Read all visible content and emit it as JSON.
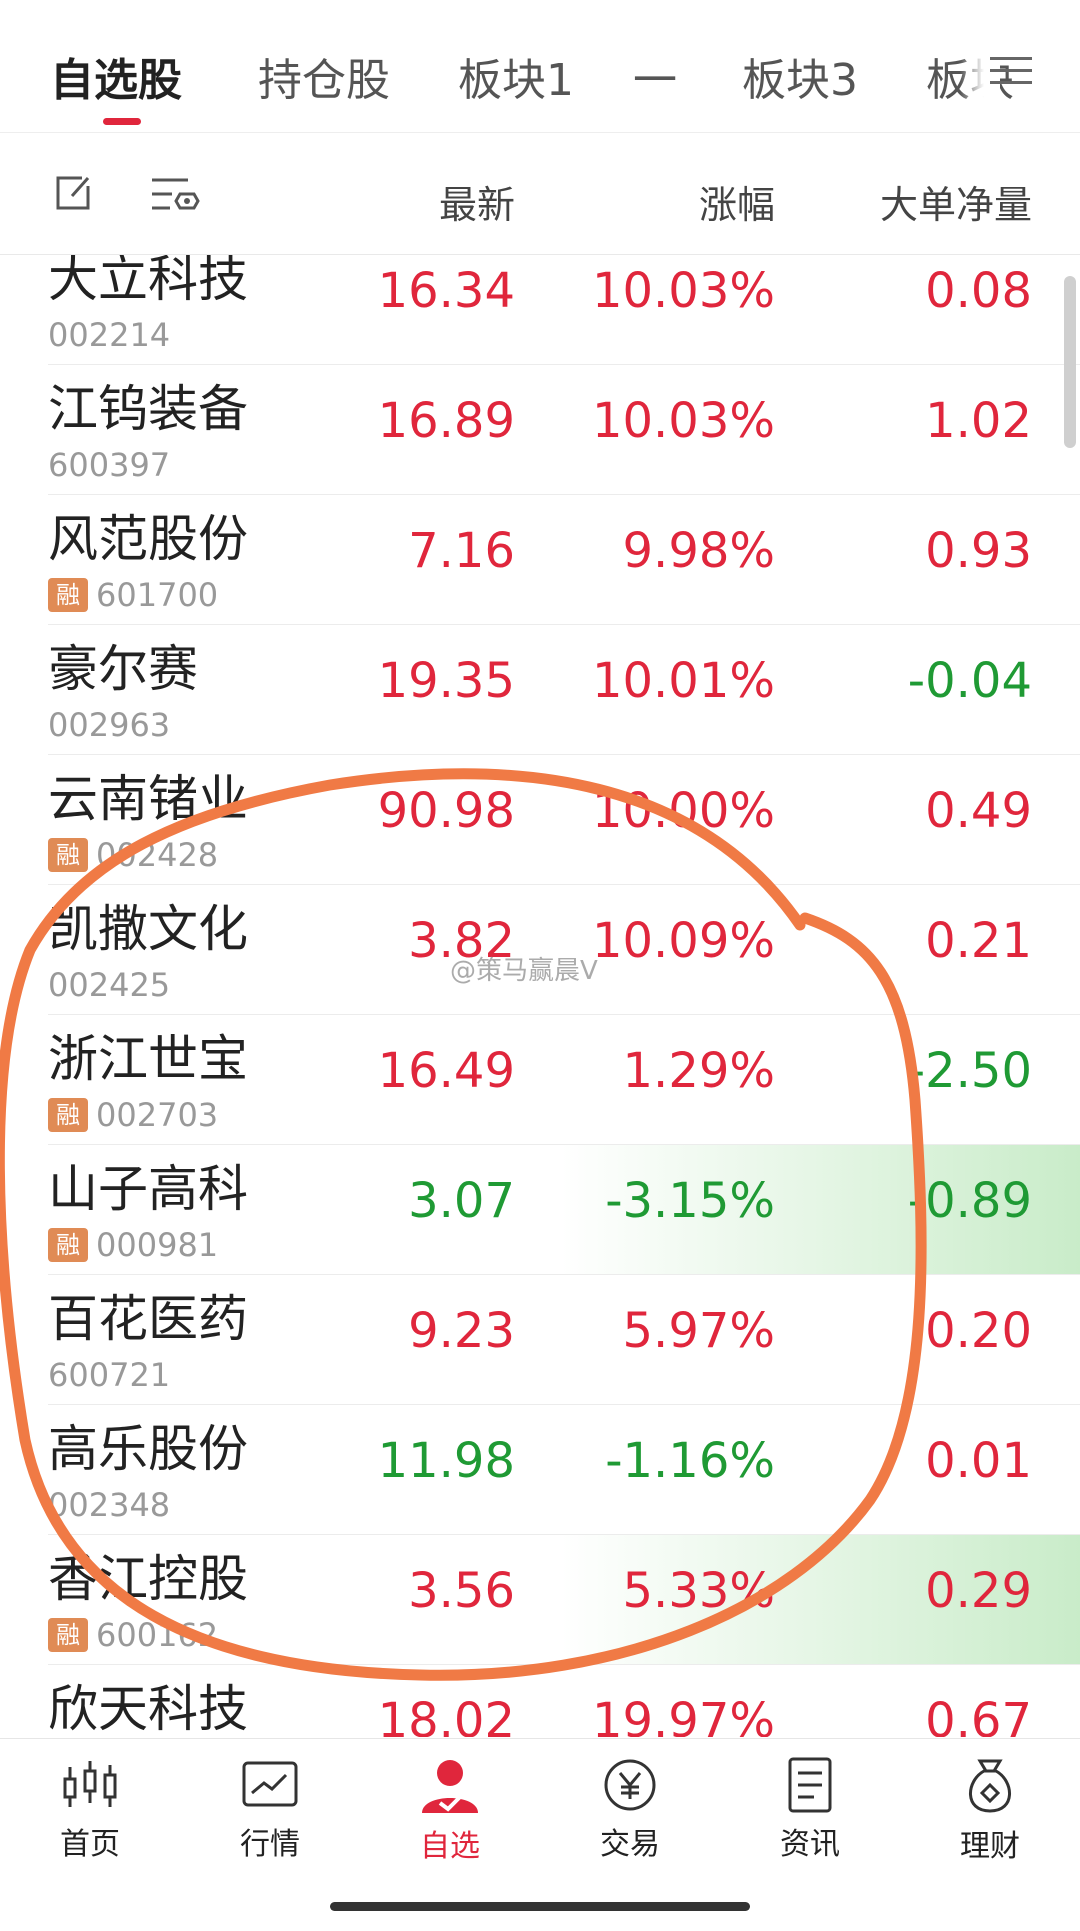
{
  "tabs": [
    {
      "label": "自选股",
      "active": true
    },
    {
      "label": "持仓股",
      "active": false
    },
    {
      "label": "板块1",
      "active": false
    },
    {
      "label": "一",
      "active": false
    },
    {
      "label": "板块3",
      "active": false
    },
    {
      "label": "板块",
      "active": false
    }
  ],
  "columns": {
    "latest": "最新",
    "change": "涨幅",
    "net_volume": "大单净量"
  },
  "stocks": [
    {
      "name": "大立科技",
      "code": "002214",
      "margin": false,
      "latest": "16.34",
      "change": "10.03%",
      "net": "0.08",
      "latest_dir": "up",
      "change_dir": "up",
      "net_dir": "up",
      "highlight": false
    },
    {
      "name": "江钨装备",
      "code": "600397",
      "margin": false,
      "latest": "16.89",
      "change": "10.03%",
      "net": "1.02",
      "latest_dir": "up",
      "change_dir": "up",
      "net_dir": "up",
      "highlight": false
    },
    {
      "name": "风范股份",
      "code": "601700",
      "margin": true,
      "latest": "7.16",
      "change": "9.98%",
      "net": "0.93",
      "latest_dir": "up",
      "change_dir": "up",
      "net_dir": "up",
      "highlight": false
    },
    {
      "name": "豪尔赛",
      "code": "002963",
      "margin": false,
      "latest": "19.35",
      "change": "10.01%",
      "net": "-0.04",
      "latest_dir": "up",
      "change_dir": "up",
      "net_dir": "down",
      "highlight": false
    },
    {
      "name": "云南锗业",
      "code": "002428",
      "margin": true,
      "latest": "90.98",
      "change": "10.00%",
      "net": "0.49",
      "latest_dir": "up",
      "change_dir": "up",
      "net_dir": "up",
      "highlight": false
    },
    {
      "name": "凯撒文化",
      "code": "002425",
      "margin": false,
      "latest": "3.82",
      "change": "10.09%",
      "net": "0.21",
      "latest_dir": "up",
      "change_dir": "up",
      "net_dir": "up",
      "highlight": false
    },
    {
      "name": "浙江世宝",
      "code": "002703",
      "margin": true,
      "latest": "16.49",
      "change": "1.29%",
      "net": "-2.50",
      "latest_dir": "up",
      "change_dir": "up",
      "net_dir": "down",
      "highlight": false
    },
    {
      "name": "山子高科",
      "code": "000981",
      "margin": true,
      "latest": "3.07",
      "change": "-3.15%",
      "net": "-0.89",
      "latest_dir": "down",
      "change_dir": "down",
      "net_dir": "down",
      "highlight": true
    },
    {
      "name": "百花医药",
      "code": "600721",
      "margin": false,
      "latest": "9.23",
      "change": "5.97%",
      "net": "0.20",
      "latest_dir": "up",
      "change_dir": "up",
      "net_dir": "up",
      "highlight": false
    },
    {
      "name": "高乐股份",
      "code": "002348",
      "margin": false,
      "latest": "11.98",
      "change": "-1.16%",
      "net": "0.01",
      "latest_dir": "down",
      "change_dir": "down",
      "net_dir": "up",
      "highlight": false
    },
    {
      "name": "香江控股",
      "code": "600162",
      "margin": true,
      "latest": "3.56",
      "change": "5.33%",
      "net": "0.29",
      "latest_dir": "up",
      "change_dir": "up",
      "net_dir": "up",
      "highlight": true
    },
    {
      "name": "欣天科技",
      "code": "",
      "margin": false,
      "latest": "18.02",
      "change": "19.97%",
      "net": "0.67",
      "latest_dir": "up",
      "change_dir": "up",
      "net_dir": "up",
      "highlight": false
    }
  ],
  "margin_badge": "融",
  "watermark": "@策马赢晨V",
  "bottom_nav": [
    {
      "label": "首页",
      "icon": "candlestick-icon",
      "active": false
    },
    {
      "label": "行情",
      "icon": "chart-line-icon",
      "active": false
    },
    {
      "label": "自选",
      "icon": "user-check-icon",
      "active": true
    },
    {
      "label": "交易",
      "icon": "yen-coin-icon",
      "active": false
    },
    {
      "label": "资讯",
      "icon": "document-icon",
      "active": false
    },
    {
      "label": "理财",
      "icon": "money-bag-icon",
      "active": false
    }
  ],
  "colors": {
    "up": "#e0263c",
    "down": "#1f9a34",
    "accent": "#e0263c",
    "annotation": "#f07a45"
  }
}
